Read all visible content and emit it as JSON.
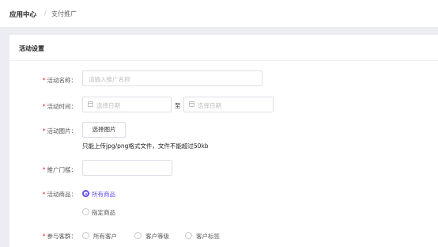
{
  "breadcrumb": {
    "root": "应用中心",
    "separator": "/",
    "current": "支付推广"
  },
  "section": {
    "title": "活动设置"
  },
  "form": {
    "required_mark": "*",
    "name": {
      "label": "活动名称：",
      "placeholder": "请输入推广名称"
    },
    "time": {
      "label": "活动时间：",
      "start_placeholder": "选择日期",
      "separator": "至",
      "end_placeholder": "选择日期"
    },
    "image": {
      "label": "活动图片：",
      "button": "选择图片",
      "hint": "只能上传jpg/png格式文件，文件不能超过50kb"
    },
    "threshold": {
      "label": "推广门槛：",
      "placeholder": ""
    },
    "goods": {
      "label": "活动商品：",
      "options": [
        "所有商品",
        "指定商品"
      ],
      "selected": "所有商品"
    },
    "audience": {
      "label": "参与客群：",
      "options": [
        "所有客户",
        "客户等级",
        "客户标签"
      ]
    }
  },
  "colors": {
    "accent": "#5e4ee8",
    "required": "#f5222d"
  }
}
